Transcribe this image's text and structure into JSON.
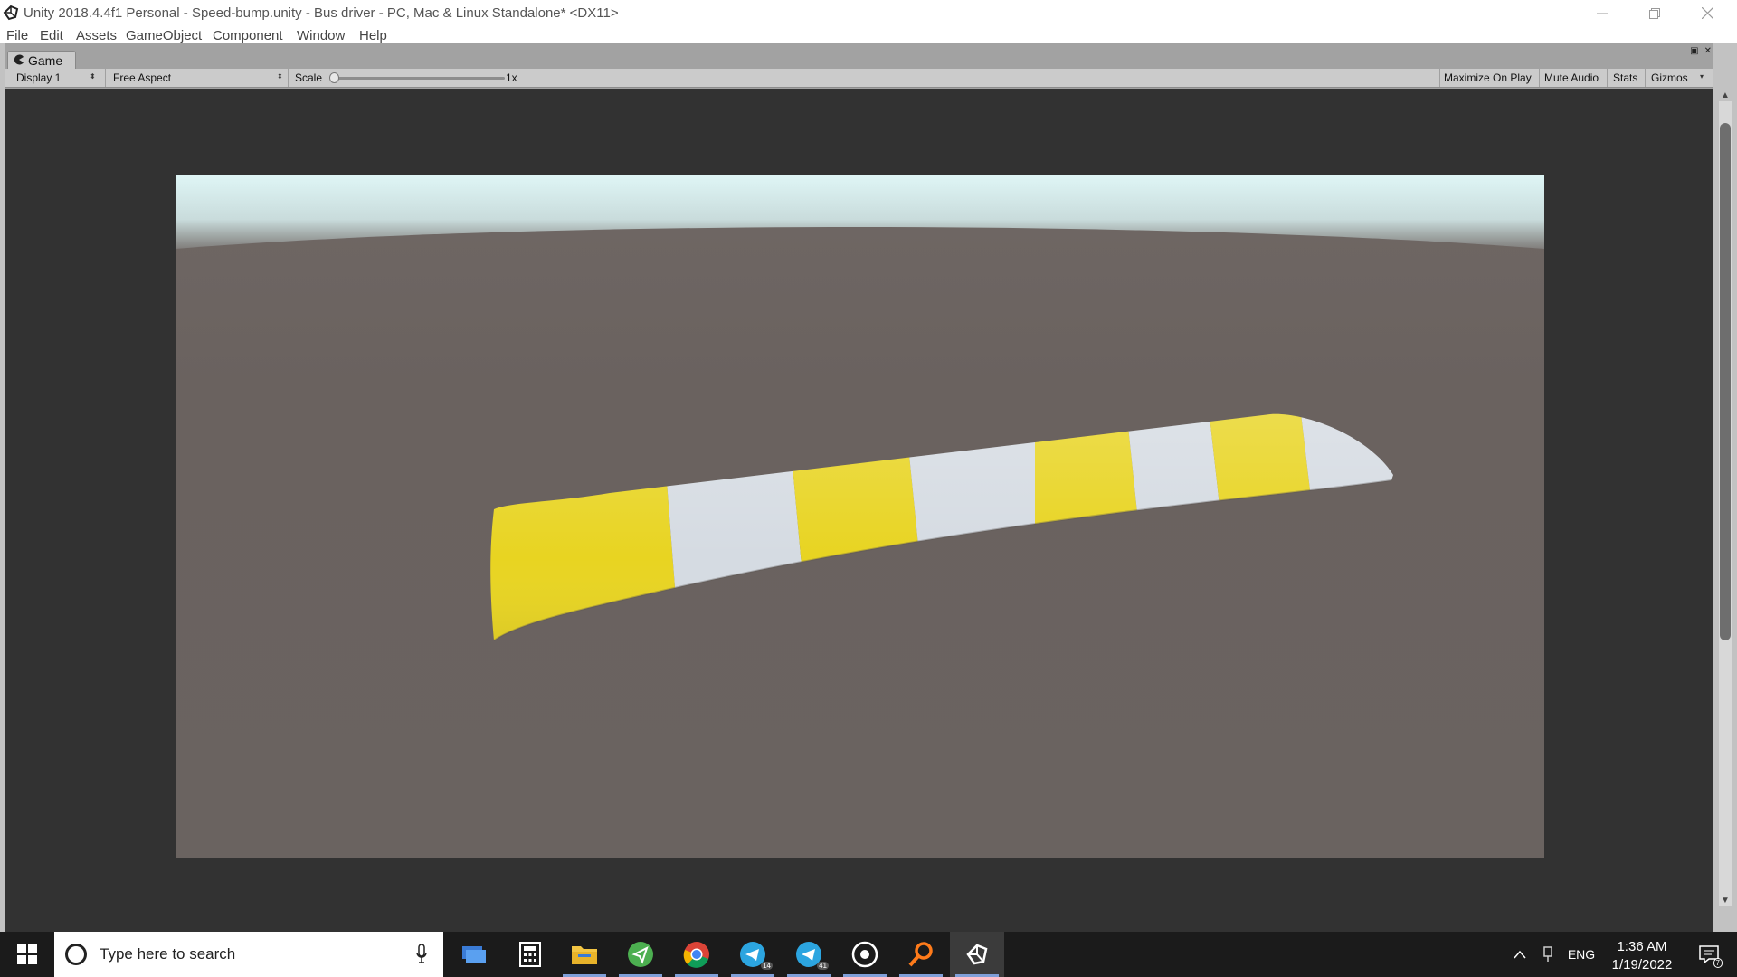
{
  "window": {
    "title": "Unity 2018.4.4f1 Personal - Speed-bump.unity - Bus driver - PC, Mac & Linux Standalone* <DX11>"
  },
  "menu": {
    "items": [
      "File",
      "Edit",
      "Assets",
      "GameObject",
      "Component",
      "Window",
      "Help"
    ]
  },
  "game_tab": {
    "label": "Game"
  },
  "game_toolbar": {
    "display": "Display 1",
    "aspect": "Free Aspect",
    "scale_label": "Scale",
    "scale_value": "1x",
    "maximize_on_play": "Maximize On Play",
    "mute_audio": "Mute Audio",
    "stats": "Stats",
    "gizmos": "Gizmos"
  },
  "viewport": {
    "sky_color": "#e6f6f6",
    "ground_color": "#6b6360",
    "stripe_yellow": "#e8d421",
    "stripe_white": "#d5dbe2"
  },
  "taskbar": {
    "search_placeholder": "Type here to search",
    "apps": [
      {
        "name": "remote-desktop-icon"
      },
      {
        "name": "calculator-icon"
      },
      {
        "name": "file-explorer-icon"
      },
      {
        "name": "send-app-icon"
      },
      {
        "name": "chrome-icon"
      },
      {
        "name": "telegram-icon",
        "badge": "14"
      },
      {
        "name": "telegram-icon",
        "badge": "41"
      },
      {
        "name": "obs-icon"
      },
      {
        "name": "search-tool-icon"
      },
      {
        "name": "unity-icon"
      }
    ],
    "language": "ENG",
    "time": "1:36 AM",
    "date": "1/19/2022",
    "notification_count": "7"
  }
}
